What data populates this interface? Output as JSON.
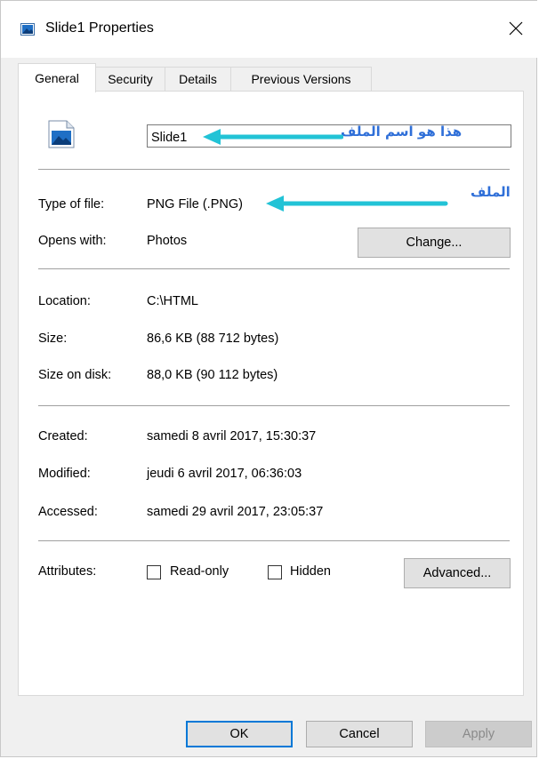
{
  "window": {
    "title": "Slide1 Properties"
  },
  "tabs": [
    {
      "label": "General",
      "active": true
    },
    {
      "label": "Security",
      "active": false
    },
    {
      "label": "Details",
      "active": false
    },
    {
      "label": "Previous Versions",
      "active": false
    }
  ],
  "general": {
    "file_name": "Slide1",
    "type_of_file_label": "Type of file:",
    "type_of_file": "PNG File (.PNG)",
    "opens_with_label": "Opens with:",
    "opens_with": "Photos",
    "change_button": "Change...",
    "location_label": "Location:",
    "location": "C:\\HTML",
    "size_label": "Size:",
    "size": "86,6 KB (88 712 bytes)",
    "size_on_disk_label": "Size on disk:",
    "size_on_disk": "88,0 KB (90 112 bytes)",
    "created_label": "Created:",
    "created": "samedi 8 avril 2017, 15:30:37",
    "modified_label": "Modified:",
    "modified": "jeudi 6 avril 2017, 06:36:03",
    "accessed_label": "Accessed:",
    "accessed": "samedi 29 avril 2017, 23:05:37",
    "attributes_label": "Attributes:",
    "readonly_label": "Read-only",
    "readonly_checked": false,
    "hidden_label": "Hidden",
    "hidden_checked": false,
    "advanced_button": "Advanced..."
  },
  "annotations": {
    "name_note": "هذا هو اسم الملف",
    "type_note": "الملف"
  },
  "footer": {
    "ok": "OK",
    "cancel": "Cancel",
    "apply": "Apply"
  },
  "colors": {
    "annotation_text": "#2f6fd8",
    "annotation_arrow": "#22c3d6",
    "focus_border": "#0078d7"
  },
  "icons": {
    "title": "image-file-icon",
    "file": "image-file-icon",
    "close": "close-icon"
  }
}
